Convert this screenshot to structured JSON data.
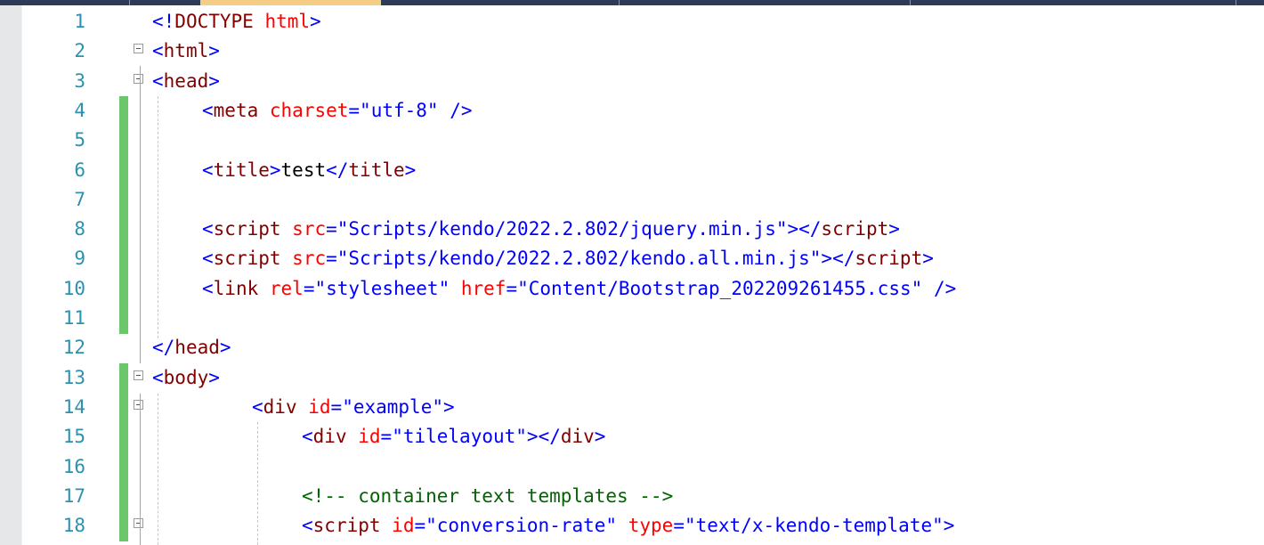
{
  "colors": {
    "line_number": "#2b91af",
    "delimiter": "#0000ff",
    "tag": "#800000",
    "attribute": "#ff0000",
    "attribute_value": "#0000ff",
    "text": "#000000",
    "comment": "#006400",
    "change_bar": "#6cc66c",
    "active_tab": "#f5cc84",
    "tabstrip": "#2d3b57"
  },
  "editor": {
    "lines": [
      {
        "num": "1",
        "segments": [
          [
            "delim",
            "<!"
          ],
          [
            "tag",
            "DOCTYPE"
          ],
          [
            "text",
            " "
          ],
          [
            "attr",
            "html"
          ],
          [
            "delim",
            ">"
          ]
        ]
      },
      {
        "num": "2",
        "segments": [
          [
            "delim",
            "<"
          ],
          [
            "tag",
            "html"
          ],
          [
            "delim",
            ">"
          ]
        ]
      },
      {
        "num": "3",
        "segments": [
          [
            "delim",
            "<"
          ],
          [
            "tag",
            "head"
          ],
          [
            "delim",
            ">"
          ]
        ]
      },
      {
        "num": "4",
        "segments": [
          [
            "delim",
            "<"
          ],
          [
            "tag",
            "meta"
          ],
          [
            "text",
            " "
          ],
          [
            "attr",
            "charset"
          ],
          [
            "delim",
            "=\""
          ],
          [
            "val",
            "utf-8"
          ],
          [
            "delim",
            "\""
          ],
          [
            "text",
            " "
          ],
          [
            "delim",
            "/>"
          ]
        ]
      },
      {
        "num": "5",
        "segments": []
      },
      {
        "num": "6",
        "segments": [
          [
            "delim",
            "<"
          ],
          [
            "tag",
            "title"
          ],
          [
            "delim",
            ">"
          ],
          [
            "text",
            "test"
          ],
          [
            "delim",
            "</"
          ],
          [
            "tag",
            "title"
          ],
          [
            "delim",
            ">"
          ]
        ]
      },
      {
        "num": "7",
        "segments": []
      },
      {
        "num": "8",
        "segments": [
          [
            "delim",
            "<"
          ],
          [
            "tag",
            "script"
          ],
          [
            "text",
            " "
          ],
          [
            "attr",
            "src"
          ],
          [
            "delim",
            "=\""
          ],
          [
            "val",
            "Scripts/kendo/2022.2.802/jquery.min.js"
          ],
          [
            "delim",
            "\"></"
          ],
          [
            "tag",
            "script"
          ],
          [
            "delim",
            ">"
          ]
        ]
      },
      {
        "num": "9",
        "segments": [
          [
            "delim",
            "<"
          ],
          [
            "tag",
            "script"
          ],
          [
            "text",
            " "
          ],
          [
            "attr",
            "src"
          ],
          [
            "delim",
            "=\""
          ],
          [
            "val",
            "Scripts/kendo/2022.2.802/kendo.all.min.js"
          ],
          [
            "delim",
            "\"></"
          ],
          [
            "tag",
            "script"
          ],
          [
            "delim",
            ">"
          ]
        ]
      },
      {
        "num": "10",
        "segments": [
          [
            "delim",
            "<"
          ],
          [
            "tag",
            "link"
          ],
          [
            "text",
            " "
          ],
          [
            "attr",
            "rel"
          ],
          [
            "delim",
            "=\""
          ],
          [
            "val",
            "stylesheet"
          ],
          [
            "delim",
            "\""
          ],
          [
            "text",
            " "
          ],
          [
            "attr",
            "href"
          ],
          [
            "delim",
            "=\""
          ],
          [
            "val",
            "Content/Bootstrap_202209261455.css"
          ],
          [
            "delim",
            "\""
          ],
          [
            "text",
            " "
          ],
          [
            "delim",
            "/>"
          ]
        ]
      },
      {
        "num": "11",
        "segments": []
      },
      {
        "num": "12",
        "segments": [
          [
            "delim",
            "</"
          ],
          [
            "tag",
            "head"
          ],
          [
            "delim",
            ">"
          ]
        ]
      },
      {
        "num": "13",
        "segments": [
          [
            "delim",
            "<"
          ],
          [
            "tag",
            "body"
          ],
          [
            "delim",
            ">"
          ]
        ]
      },
      {
        "num": "14",
        "segments": [
          [
            "delim",
            "<"
          ],
          [
            "tag",
            "div"
          ],
          [
            "text",
            " "
          ],
          [
            "attr",
            "id"
          ],
          [
            "delim",
            "=\""
          ],
          [
            "val",
            "example"
          ],
          [
            "delim",
            "\">"
          ]
        ]
      },
      {
        "num": "15",
        "segments": [
          [
            "delim",
            "<"
          ],
          [
            "tag",
            "div"
          ],
          [
            "text",
            " "
          ],
          [
            "attr",
            "id"
          ],
          [
            "delim",
            "=\""
          ],
          [
            "val",
            "tilelayout"
          ],
          [
            "delim",
            "\"></"
          ],
          [
            "tag",
            "div"
          ],
          [
            "delim",
            ">"
          ]
        ]
      },
      {
        "num": "16",
        "segments": []
      },
      {
        "num": "17",
        "segments": [
          [
            "comment",
            "<!-- container text templates -->"
          ]
        ]
      },
      {
        "num": "18",
        "segments": [
          [
            "delim",
            "<"
          ],
          [
            "tag",
            "script"
          ],
          [
            "text",
            " "
          ],
          [
            "attr",
            "id"
          ],
          [
            "delim",
            "=\""
          ],
          [
            "val",
            "conversion-rate"
          ],
          [
            "delim",
            "\""
          ],
          [
            "text",
            " "
          ],
          [
            "attr",
            "type"
          ],
          [
            "delim",
            "=\""
          ],
          [
            "val",
            "text/x-kendo-template"
          ],
          [
            "delim",
            "\">"
          ]
        ]
      }
    ]
  }
}
